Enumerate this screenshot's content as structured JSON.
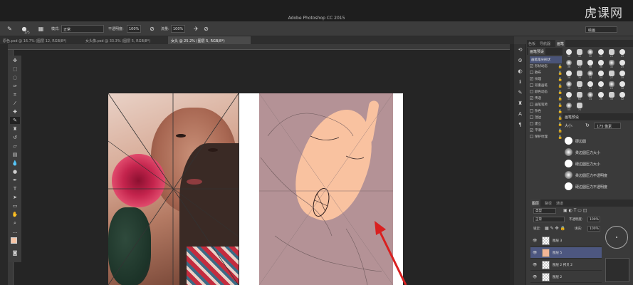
{
  "app": {
    "title": "Adobe Photoshop CC 2015",
    "watermark": "虎课网"
  },
  "options": {
    "brush_size": "175",
    "mode_label": "模式:",
    "mode_value": "正常",
    "opacity_label": "不透明度:",
    "opacity_value": "100%",
    "flow_label": "流量:",
    "flow_value": "100%",
    "workspace": "绘画"
  },
  "tabs": [
    {
      "label": "原色.psd @ 16.7% (图层 12, RGB/8*)"
    },
    {
      "label": "女头像.psd @ 33.3% (图层 5, RGB/8*)"
    },
    {
      "label": "女头 @ 25.2% (图层 5, RGB/8*)"
    }
  ],
  "tools": [
    "move-tool-icon",
    "marquee-tool-icon",
    "lasso-tool-icon",
    "quick-select-tool-icon",
    "crop-tool-icon",
    "eyedropper-tool-icon",
    "healing-tool-icon",
    "brush-tool-icon",
    "clone-stamp-tool-icon",
    "history-brush-tool-icon",
    "eraser-tool-icon",
    "gradient-tool-icon",
    "blur-tool-icon",
    "dodge-tool-icon",
    "pen-tool-icon",
    "type-tool-icon",
    "path-select-tool-icon",
    "shape-tool-icon",
    "hand-tool-icon",
    "zoom-tool-icon"
  ],
  "panel_tabs_top": [
    "色板",
    "导航器",
    "画笔",
    "画笔预设"
  ],
  "brush_panel": {
    "header": "画笔笔尖形状",
    "items": [
      {
        "label": "形状动态",
        "checked": true
      },
      {
        "label": "散布",
        "checked": false
      },
      {
        "label": "纹理",
        "checked": true
      },
      {
        "label": "双重画笔",
        "checked": false
      },
      {
        "label": "颜色动态",
        "checked": false
      },
      {
        "label": "传递",
        "checked": true
      },
      {
        "label": "画笔笔势",
        "checked": false
      },
      {
        "label": "杂色",
        "checked": false
      },
      {
        "label": "湿边",
        "checked": false
      },
      {
        "label": "建立",
        "checked": false
      },
      {
        "label": "平滑",
        "checked": true
      },
      {
        "label": "保护纹理",
        "checked": false
      }
    ],
    "tips": [
      "30",
      "30",
      "30",
      "25",
      "25",
      "25",
      "36",
      "25",
      "36",
      "36",
      "32",
      "25",
      "36",
      "36",
      "14",
      "24",
      "27",
      "39",
      "46",
      "59",
      "11",
      "17",
      "23",
      "36",
      "44",
      "60",
      "14",
      "26",
      "33",
      "42",
      "55",
      "70"
    ]
  },
  "brush_presets": {
    "header": "画笔预设",
    "size_label": "大小:",
    "size_value": "175 像素",
    "items": [
      {
        "label": "硬边圆",
        "soft": false
      },
      {
        "label": "柔边圆压力大小",
        "soft": true
      },
      {
        "label": "硬边圆压力大小",
        "soft": false
      },
      {
        "label": "柔边圆压力不透明度",
        "soft": true
      },
      {
        "label": "硬边圆压力不透明度",
        "soft": false
      }
    ]
  },
  "layers_panel": {
    "tabs": [
      "图层",
      "路径",
      "通道"
    ],
    "kind_label": "类型",
    "blend_mode": "正常",
    "opacity_label": "不透明度:",
    "opacity_value": "100%",
    "lock_label": "锁定:",
    "fill_label": "填充:",
    "fill_value": "100%",
    "layers": [
      {
        "name": "图层 3",
        "selected": false,
        "thumb": "transparent"
      },
      {
        "name": "图层 5",
        "selected": true,
        "thumb": "peach"
      },
      {
        "name": "图层 2 拷贝 2",
        "selected": false,
        "thumb": "transparent"
      },
      {
        "name": "图层 2",
        "selected": false,
        "thumb": "transparent"
      }
    ]
  },
  "colors": {
    "accent_selected": "#4d5780",
    "sketch_bg": "#b49296",
    "skin_fill": "#f9c2a0",
    "arrow": "#d92020"
  }
}
